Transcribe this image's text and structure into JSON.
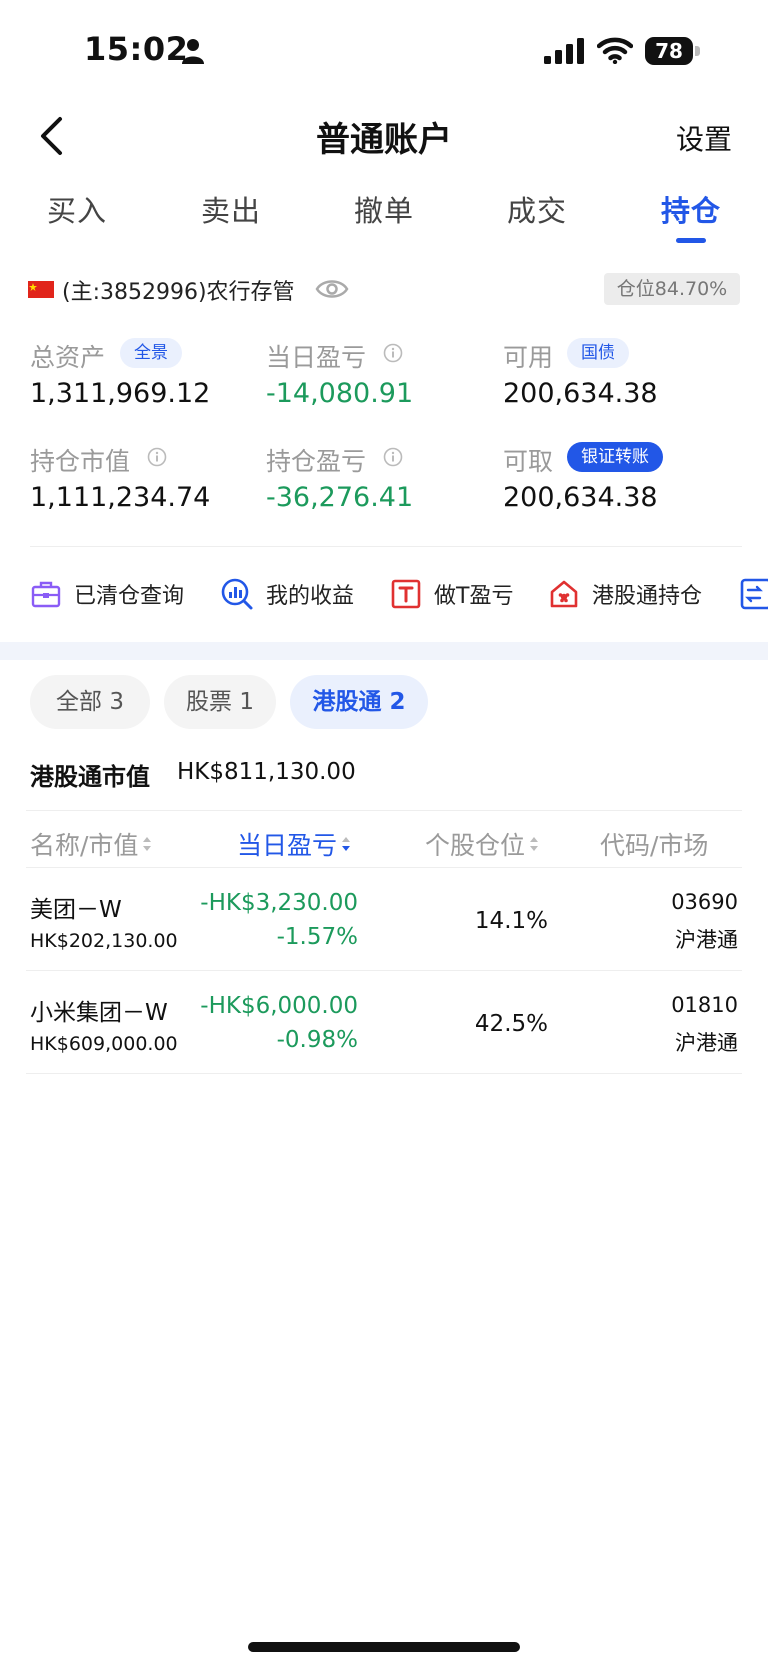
{
  "status_bar": {
    "time": "15:02",
    "battery": "78"
  },
  "nav": {
    "title": "普通账户",
    "settings": "设置"
  },
  "tabs": [
    {
      "label": "买入"
    },
    {
      "label": "卖出"
    },
    {
      "label": "撤单"
    },
    {
      "label": "成交"
    },
    {
      "label": "持仓"
    }
  ],
  "account": {
    "text": "(主:3852996)农行存管",
    "position_ratio": "仓位84.70%"
  },
  "stats": {
    "total_assets": {
      "label": "总资产",
      "value": "1,311,969.12",
      "tag": "全景"
    },
    "daily_pnl": {
      "label": "当日盈亏",
      "value": "-14,080.91"
    },
    "available": {
      "label": "可用",
      "value": "200,634.38",
      "tag": "国债"
    },
    "holding_value": {
      "label": "持仓市值",
      "value": "1,111,234.74"
    },
    "holding_pnl": {
      "label": "持仓盈亏",
      "value": "-36,276.41"
    },
    "withdrawable": {
      "label": "可取",
      "value": "200,634.38",
      "tag": "银证转账"
    }
  },
  "quick_actions": [
    {
      "label": "已清仓查询",
      "icon": "briefcase-icon"
    },
    {
      "label": "我的收益",
      "icon": "chart-search-icon"
    },
    {
      "label": "做T盈亏",
      "icon": "t-square-icon"
    },
    {
      "label": "港股通持仓",
      "icon": "hk-house-icon"
    }
  ],
  "filters": [
    {
      "label": "全部 3"
    },
    {
      "label": "股票 1"
    },
    {
      "label": "港股通 2"
    }
  ],
  "market_value": {
    "label": "港股通市值",
    "value": "HK$811,130.00"
  },
  "table": {
    "headers": [
      "名称/市值",
      "当日盈亏",
      "个股仓位",
      "代码/市场"
    ],
    "rows": [
      {
        "name": "美团－W",
        "value": "HK$202,130.00",
        "pnl": "-HK$3,230.00",
        "pnl_pct": "-1.57%",
        "position": "14.1%",
        "code": "03690",
        "market": "沪港通"
      },
      {
        "name": "小米集团－W",
        "value": "HK$609,000.00",
        "pnl": "-HK$6,000.00",
        "pnl_pct": "-0.98%",
        "position": "42.5%",
        "code": "01810",
        "market": "沪港通"
      }
    ]
  },
  "colors": {
    "accent": "#2257e7",
    "negative": "#1c9a5c"
  }
}
